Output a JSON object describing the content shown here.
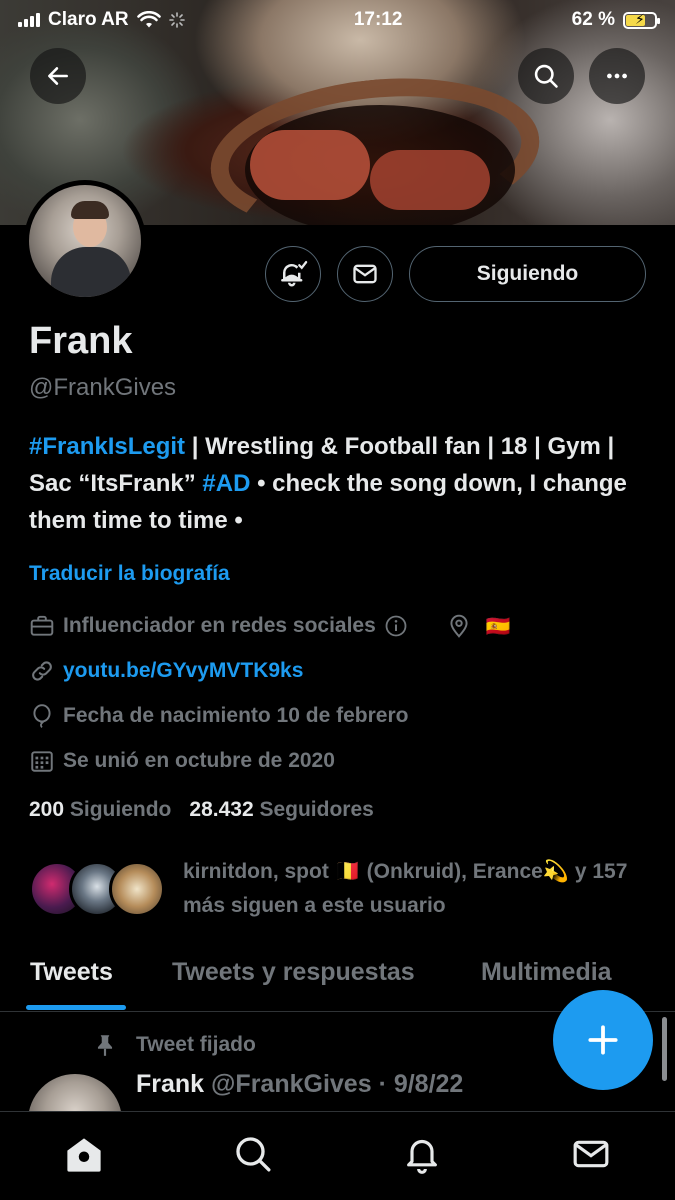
{
  "status_bar": {
    "carrier": "Claro AR",
    "time": "17:12",
    "battery_percent": "62 %",
    "battery_level": 0.62
  },
  "profile": {
    "name": "Frank",
    "handle": "@FrankGives",
    "follow_button_label": "Siguiendo",
    "bio": {
      "tag1": "#FrankIsLegit",
      "part1": " | Wrestling & Football fan | 18 | Gym | Sac “ItsFrank” ",
      "tag2": "#AD",
      "part2": " • check the song down, I change them time to time •"
    },
    "translate_label": "Traducir la biografía",
    "category": "Influenciador en redes sociales",
    "location_flag": "🇪🇸",
    "link": "youtu.be/GYvyMVTK9ks",
    "birthday": "Fecha de nacimiento 10 de febrero",
    "joined": "Se unió en octubre de 2020",
    "following_count": "200",
    "following_label": "Siguiendo",
    "followers_count": "28.432",
    "followers_label": "Seguidores",
    "followed_by_text": "kirnitdon, spot 🇧🇪 (Onkruid), Erance💫 y 157 más siguen a este usuario"
  },
  "tabs": [
    {
      "label": "Tweets",
      "active": true
    },
    {
      "label": "Tweets y respuestas",
      "active": false
    },
    {
      "label": "Multimedia",
      "active": false
    }
  ],
  "pinned_tweet": {
    "pinned_label": "Tweet fijado",
    "author_name": "Frank",
    "author_handle": "@FrankGives",
    "date": "· 9/8/22"
  },
  "colors": {
    "accent": "#1d9bf0",
    "background": "#000000",
    "muted_text": "#71767b",
    "primary_text": "#e7e9ea"
  },
  "icons": {
    "back": "arrow-left-icon",
    "search": "search-icon",
    "more": "more-horizontal-icon",
    "notify": "bell-check-icon",
    "message": "envelope-icon",
    "category": "briefcase-icon",
    "info": "info-icon",
    "location": "location-pin-icon",
    "link": "link-icon",
    "birthday": "balloon-icon",
    "joined": "calendar-icon",
    "pin": "pin-icon",
    "compose": "plus-icon",
    "nav_home": "home-icon",
    "nav_search": "search-icon",
    "nav_notifications": "bell-icon",
    "nav_messages": "envelope-icon"
  }
}
